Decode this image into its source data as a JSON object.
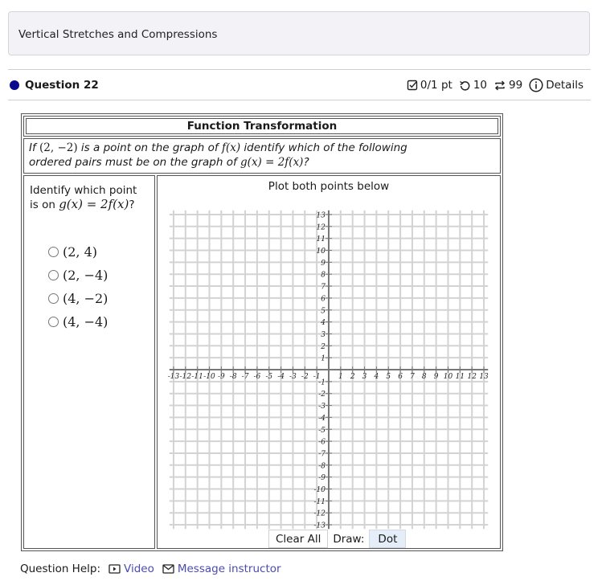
{
  "banner": {
    "title": "Vertical Stretches and Compressions"
  },
  "question": {
    "title": "Question 22",
    "score": "0/1 pt",
    "retries": "10",
    "attempts": "99",
    "details_label": "Details",
    "status_color": "#0a0a8c"
  },
  "problem": {
    "table_title": "Function Transformation",
    "prompt_parts": [
      "If ",
      "(2, −2)",
      " is a point on the graph of ",
      "f(x)",
      " identify which of the following",
      "ordered pairs must be on the graph of ",
      "g(x) = 2f(x)",
      "?"
    ],
    "left_prompt_text": "Identify which point is on ",
    "left_prompt_math": "g(x) = 2f(x)",
    "left_prompt_end": "?",
    "options": [
      {
        "label": "(2, 4)",
        "selected": false
      },
      {
        "label": "(2, −4)",
        "selected": false
      },
      {
        "label": "(4, −2)",
        "selected": false
      },
      {
        "label": "(4, −4)",
        "selected": false
      }
    ]
  },
  "plot": {
    "title": "Plot both points below",
    "clear_label": "Clear All",
    "draw_label": "Draw:",
    "dot_label": "Dot",
    "x_range": [
      -13,
      13
    ],
    "y_range": [
      -13,
      13
    ],
    "x_ticks": [
      "-13",
      "-12",
      "-11",
      "-10",
      "-9",
      "-8",
      "-7",
      "-6",
      "-5",
      "-4",
      "-3",
      "-2",
      "-1",
      "1",
      "2",
      "3",
      "4",
      "5",
      "6",
      "7",
      "8",
      "9",
      "10",
      "11",
      "12",
      "13"
    ],
    "y_ticks": [
      "13",
      "12",
      "11",
      "10",
      "9",
      "8",
      "7",
      "6",
      "5",
      "4",
      "3",
      "2",
      "1",
      "-1",
      "-2",
      "-3",
      "-4",
      "-5",
      "-6",
      "-7",
      "-8",
      "-9",
      "-10",
      "-11",
      "-12",
      "-13"
    ]
  },
  "help": {
    "label": "Question Help:",
    "video_label": "Video",
    "message_label": "Message instructor",
    "link_color": "#4b4bb0"
  }
}
